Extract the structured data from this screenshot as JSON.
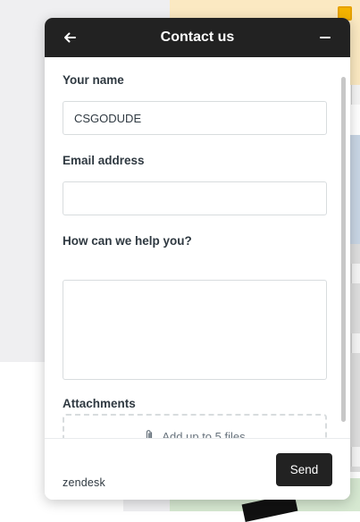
{
  "header": {
    "title": "Contact us",
    "back_icon": "arrow-left-icon",
    "minimize_icon": "minus-icon"
  },
  "form": {
    "name_label": "Your name",
    "name_value": "CSGODUDE",
    "email_label": "Email address",
    "email_value": "",
    "help_label": "How can we help you?",
    "help_value": "",
    "attachments_label": "Attachments",
    "attachments_hint": "Add up to 5 files",
    "attachments_icon": "paperclip-icon"
  },
  "footer": {
    "brand": "zendesk",
    "send_label": "Send"
  },
  "colors": {
    "header_bg": "#222222",
    "send_bg": "#222222",
    "border": "#d8dcde"
  }
}
